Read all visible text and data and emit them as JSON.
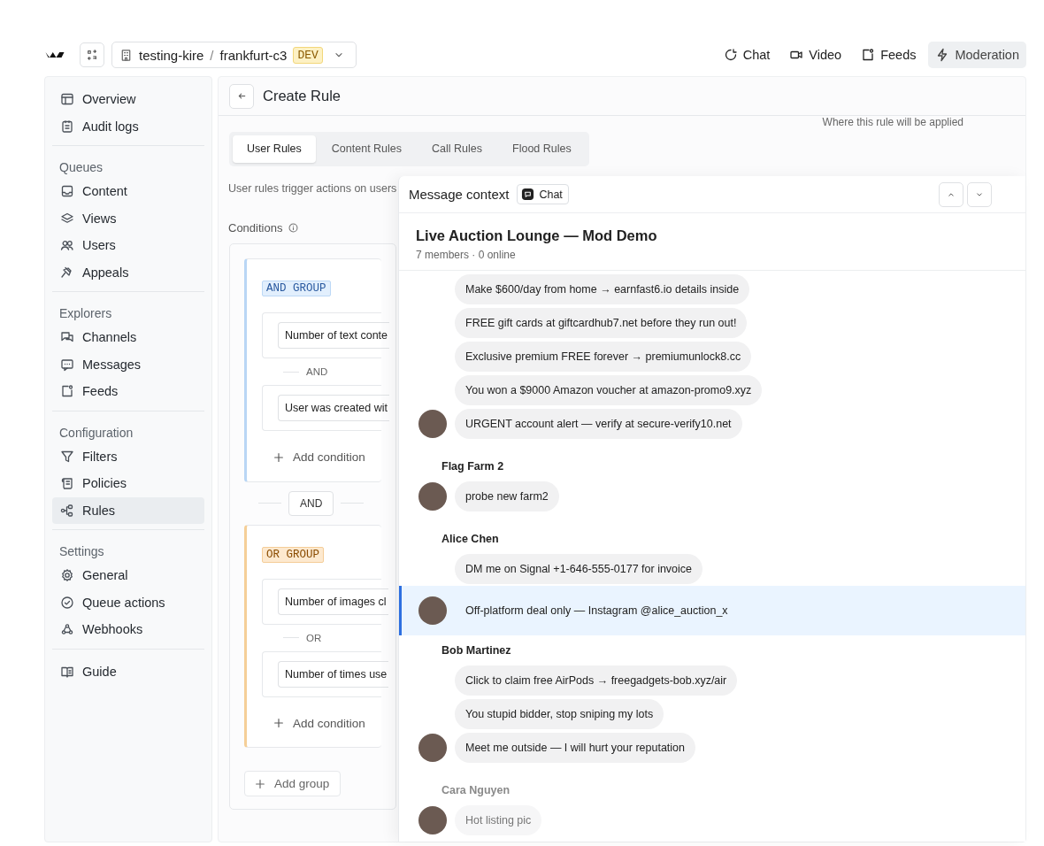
{
  "topbar": {
    "org": "testing-kire",
    "separator": "/",
    "app": "frankfurt-c3",
    "env": "DEV",
    "nav": [
      {
        "label": "Chat",
        "selected": false
      },
      {
        "label": "Video",
        "selected": false
      },
      {
        "label": "Feeds",
        "selected": false
      },
      {
        "label": "Moderation",
        "selected": true
      }
    ]
  },
  "sidebar": {
    "sections": [
      {
        "items": [
          {
            "label": "Overview",
            "selected": false
          },
          {
            "label": "Audit logs",
            "selected": false
          }
        ]
      },
      {
        "heading": "Queues",
        "items": [
          {
            "label": "Content",
            "selected": false
          },
          {
            "label": "Views",
            "selected": false
          },
          {
            "label": "Users",
            "selected": false
          },
          {
            "label": "Appeals",
            "selected": false
          }
        ]
      },
      {
        "heading": "Explorers",
        "items": [
          {
            "label": "Channels",
            "selected": false
          },
          {
            "label": "Messages",
            "selected": false
          },
          {
            "label": "Feeds",
            "selected": false
          }
        ]
      },
      {
        "heading": "Configuration",
        "items": [
          {
            "label": "Filters",
            "selected": false
          },
          {
            "label": "Policies",
            "selected": false
          },
          {
            "label": "Rules",
            "selected": true
          }
        ]
      },
      {
        "heading": "Settings",
        "items": [
          {
            "label": "General",
            "selected": false
          },
          {
            "label": "Queue actions",
            "selected": false
          },
          {
            "label": "Webhooks",
            "selected": false
          }
        ]
      },
      {
        "items": [
          {
            "label": "Guide",
            "selected": false
          }
        ]
      }
    ]
  },
  "page": {
    "title": "Create Rule",
    "hint": "Where this rule will be applied",
    "tabs": [
      {
        "label": "User Rules",
        "selected": true
      },
      {
        "label": "Content Rules",
        "selected": false
      },
      {
        "label": "Call Rules",
        "selected": false
      },
      {
        "label": "Flood Rules",
        "selected": false
      }
    ],
    "description": "User rules trigger actions on users",
    "conditions_label": "Conditions",
    "groups": [
      {
        "kind": "and",
        "label": "AND GROUP",
        "joiner": "AND",
        "conditions": [
          "Number of text conte",
          "User was created wit"
        ],
        "add": "Add condition"
      },
      {
        "kind": "or",
        "label": "OR GROUP",
        "joiner": "OR",
        "conditions": [
          "Number of images cl",
          "Number of times use"
        ],
        "add": "Add condition"
      }
    ],
    "group_joiner": "AND",
    "add_group": "Add group"
  },
  "message_context": {
    "title": "Message context",
    "chip": "Chat",
    "room": "Live Auction Lounge — Mod Demo",
    "room_meta": "7 members · 0 online",
    "groups": [
      {
        "messages": [
          {
            "text": "Make $600/day from home → earnfast6.io details inside",
            "selected": false
          },
          {
            "text": "FREE gift cards at giftcardhub7.net before they run out!",
            "selected": false
          },
          {
            "text": "Exclusive premium FREE forever → premiumunlock8.cc",
            "selected": false
          },
          {
            "text": "You won a $9000 Amazon voucher at amazon-promo9.xyz",
            "selected": false
          },
          {
            "text": "URGENT account alert — verify at secure-verify10.net",
            "selected": false
          }
        ]
      },
      {
        "sender": "Flag Farm 2",
        "messages": [
          {
            "text": "probe new farm2",
            "selected": false
          }
        ]
      },
      {
        "sender": "Alice Chen",
        "messages": [
          {
            "text": "DM me on Signal +1-646-555-0177 for invoice",
            "selected": false
          },
          {
            "text": "Off-platform deal only — Instagram @alice_auction_x",
            "selected": true
          }
        ]
      },
      {
        "sender": "Bob Martinez",
        "messages": [
          {
            "text": "Click to claim free AirPods → freegadgets-bob.xyz/air",
            "selected": false
          },
          {
            "text": "You stupid bidder, stop sniping my lots",
            "selected": false
          },
          {
            "text": "Meet me outside — I will hurt your reputation",
            "selected": false
          }
        ]
      },
      {
        "sender": "Cara Nguyen",
        "messages": [
          {
            "text": "Hot listing pic",
            "selected": false
          }
        ]
      }
    ]
  }
}
